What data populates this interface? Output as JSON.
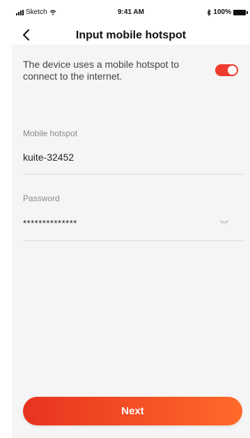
{
  "status_bar": {
    "carrier": "Sketch",
    "time": "9:41 AM",
    "battery": "100%"
  },
  "header": {
    "title": "Input mobile hotspot",
    "back_icon": "chevron-left-icon"
  },
  "hotspot_toggle": {
    "description": "The device uses a mobile hotspot to connect to the internet.",
    "enabled": true,
    "accent_color": "#ef3b2d"
  },
  "fields": {
    "hotspot": {
      "label": "Mobile hotspot",
      "value": "kuite-32452"
    },
    "password": {
      "label": "Password",
      "value": "**************",
      "visibility_icon": "eye-hidden-icon"
    }
  },
  "actions": {
    "next_label": "Next"
  }
}
